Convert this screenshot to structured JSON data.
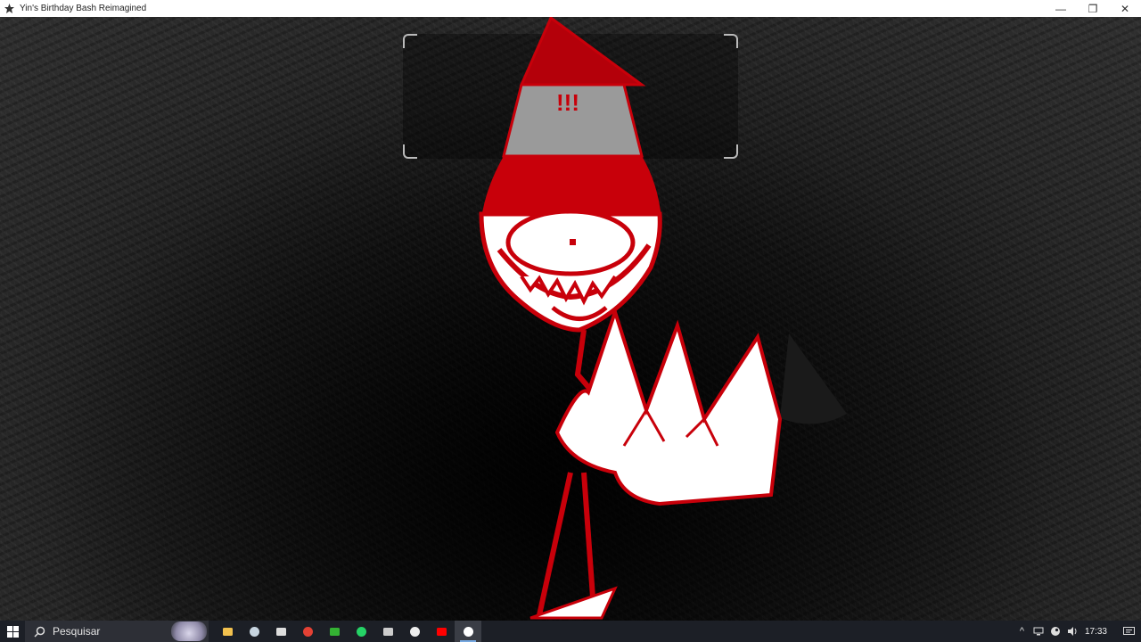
{
  "window": {
    "title": "Yin's Birthday Bash Reimagined",
    "minimize_glyph": "—",
    "maximize_glyph": "❐",
    "close_glyph": "✕"
  },
  "scene": {
    "character_hat_marks": "!!!"
  },
  "taskbar": {
    "search_placeholder": "Pesquisar",
    "apps": [
      {
        "name": "file-explorer-icon",
        "color": "#f2c14e"
      },
      {
        "name": "steam-icon",
        "color": "#c7d5e0"
      },
      {
        "name": "terminal-icon",
        "color": "#dddddd"
      },
      {
        "name": "chrome-icon",
        "color": "#e44134"
      },
      {
        "name": "xbox-icon",
        "color": "#34b233"
      },
      {
        "name": "whatsapp-icon",
        "color": "#25d366"
      },
      {
        "name": "clock-app-icon",
        "color": "#cccccc"
      },
      {
        "name": "notepad-icon",
        "color": "#eeeeee"
      },
      {
        "name": "youtube-icon",
        "color": "#ff0000"
      },
      {
        "name": "game-app-icon",
        "color": "#ffffff"
      }
    ],
    "time": "17:33",
    "tray_chevron": "^"
  },
  "colors": {
    "accent_red": "#c8000a",
    "taskbar_bg": "#1c1f26"
  }
}
